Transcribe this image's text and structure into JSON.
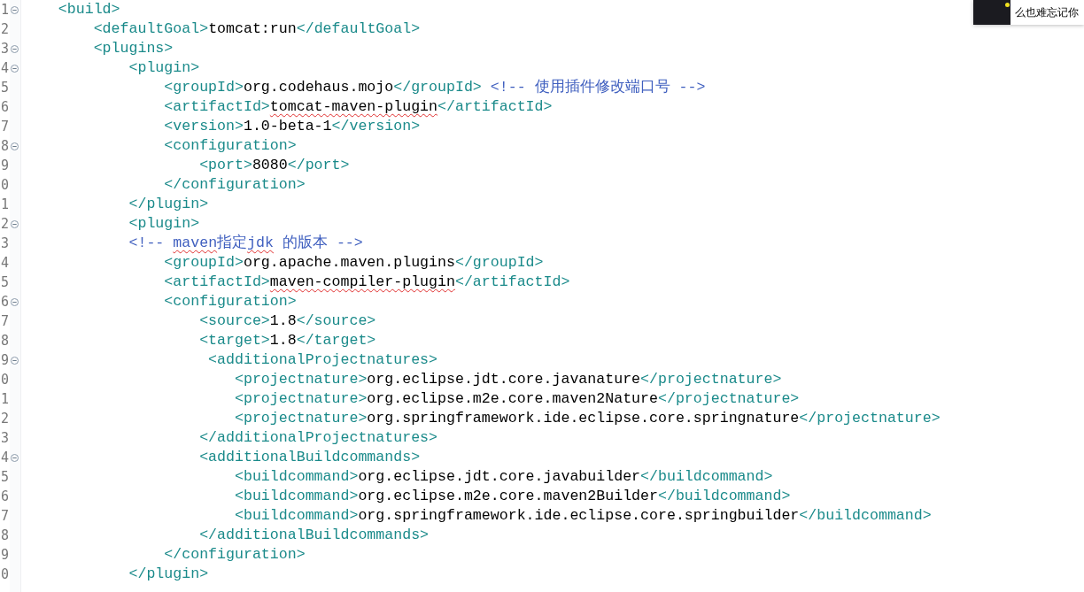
{
  "editor": {
    "lines": [
      {
        "number": "1",
        "foldable": true,
        "tokens": [
          {
            "kind": "tag",
            "text": "    <build>"
          }
        ]
      },
      {
        "number": "2",
        "foldable": false,
        "tokens": [
          {
            "kind": "tag",
            "text": "        <defaultGoal>"
          },
          {
            "kind": "text",
            "text": "tomcat:run"
          },
          {
            "kind": "tag",
            "text": "</defaultGoal>"
          }
        ]
      },
      {
        "number": "3",
        "foldable": true,
        "tokens": [
          {
            "kind": "tag",
            "text": "        <plugins>"
          }
        ]
      },
      {
        "number": "4",
        "foldable": true,
        "tokens": [
          {
            "kind": "tag",
            "text": "            <plugin>"
          }
        ]
      },
      {
        "number": "5",
        "foldable": false,
        "tokens": [
          {
            "kind": "tag",
            "text": "                <groupId>"
          },
          {
            "kind": "text",
            "text": "org.codehaus.mojo"
          },
          {
            "kind": "tag",
            "text": "</groupId>"
          },
          {
            "kind": "comment",
            "text": " <!-- 使用插件修改端口号 -->"
          }
        ]
      },
      {
        "number": "6",
        "foldable": false,
        "tokens": [
          {
            "kind": "tag",
            "text": "                <artifactId>"
          },
          {
            "kind": "text",
            "text": "tomcat-maven-plugin",
            "misspelled": true
          },
          {
            "kind": "tag",
            "text": "</artifactId>"
          }
        ]
      },
      {
        "number": "7",
        "foldable": false,
        "tokens": [
          {
            "kind": "tag",
            "text": "                <version>"
          },
          {
            "kind": "text",
            "text": "1.0-beta-1"
          },
          {
            "kind": "tag",
            "text": "</version>"
          }
        ]
      },
      {
        "number": "8",
        "foldable": true,
        "tokens": [
          {
            "kind": "tag",
            "text": "                <configuration>"
          }
        ]
      },
      {
        "number": "9",
        "foldable": false,
        "tokens": [
          {
            "kind": "tag",
            "text": "                    <port>"
          },
          {
            "kind": "text",
            "text": "8080"
          },
          {
            "kind": "tag",
            "text": "</port>"
          }
        ]
      },
      {
        "number": "0",
        "foldable": false,
        "tokens": [
          {
            "kind": "tag",
            "text": "                </configuration>"
          }
        ]
      },
      {
        "number": "1",
        "foldable": false,
        "tokens": [
          {
            "kind": "tag",
            "text": "            </plugin>"
          }
        ]
      },
      {
        "number": "2",
        "foldable": true,
        "tokens": [
          {
            "kind": "tag",
            "text": "            <plugin>"
          }
        ]
      },
      {
        "number": "3",
        "foldable": false,
        "tokens": [
          {
            "kind": "comment",
            "text": "            <!-- "
          },
          {
            "kind": "comment",
            "text": "maven",
            "misspelled": true
          },
          {
            "kind": "comment",
            "text": "指定"
          },
          {
            "kind": "comment",
            "text": "jdk",
            "misspelled": true
          },
          {
            "kind": "comment",
            "text": " 的版本 -->"
          }
        ]
      },
      {
        "number": "4",
        "foldable": false,
        "tokens": [
          {
            "kind": "tag",
            "text": "                <groupId>"
          },
          {
            "kind": "text",
            "text": "org.apache.maven.plugins"
          },
          {
            "kind": "tag",
            "text": "</groupId>"
          }
        ]
      },
      {
        "number": "5",
        "foldable": false,
        "tokens": [
          {
            "kind": "tag",
            "text": "                <artifactId>"
          },
          {
            "kind": "text",
            "text": "maven-compiler-plugin",
            "misspelled": true
          },
          {
            "kind": "tag",
            "text": "</artifactId>"
          }
        ]
      },
      {
        "number": "6",
        "foldable": true,
        "tokens": [
          {
            "kind": "tag",
            "text": "                <configuration>"
          }
        ]
      },
      {
        "number": "7",
        "foldable": false,
        "tokens": [
          {
            "kind": "tag",
            "text": "                    <source>"
          },
          {
            "kind": "text",
            "text": "1.8"
          },
          {
            "kind": "tag",
            "text": "</source>"
          }
        ]
      },
      {
        "number": "8",
        "foldable": false,
        "tokens": [
          {
            "kind": "tag",
            "text": "                    <target>"
          },
          {
            "kind": "text",
            "text": "1.8"
          },
          {
            "kind": "tag",
            "text": "</target>"
          }
        ]
      },
      {
        "number": "9",
        "foldable": true,
        "tokens": [
          {
            "kind": "tag",
            "text": "                     <additionalProjectnatures>"
          }
        ]
      },
      {
        "number": "0",
        "foldable": false,
        "tokens": [
          {
            "kind": "tag",
            "text": "                        <projectnature>"
          },
          {
            "kind": "text",
            "text": "org.eclipse.jdt.core.javanature"
          },
          {
            "kind": "tag",
            "text": "</projectnature>"
          }
        ]
      },
      {
        "number": "1",
        "foldable": false,
        "tokens": [
          {
            "kind": "tag",
            "text": "                        <projectnature>"
          },
          {
            "kind": "text",
            "text": "org.eclipse.m2e.core.maven2Nature"
          },
          {
            "kind": "tag",
            "text": "</projectnature>"
          }
        ]
      },
      {
        "number": "2",
        "foldable": false,
        "tokens": [
          {
            "kind": "tag",
            "text": "                        <projectnature>"
          },
          {
            "kind": "text",
            "text": "org.springframework.ide.eclipse.core.springnature"
          },
          {
            "kind": "tag",
            "text": "</projectnature>"
          }
        ]
      },
      {
        "number": "3",
        "foldable": false,
        "tokens": [
          {
            "kind": "tag",
            "text": "                    </additionalProjectnatures>"
          }
        ]
      },
      {
        "number": "4",
        "foldable": true,
        "tokens": [
          {
            "kind": "tag",
            "text": "                    <additionalBuildcommands>"
          }
        ]
      },
      {
        "number": "5",
        "foldable": false,
        "tokens": [
          {
            "kind": "tag",
            "text": "                        <buildcommand>"
          },
          {
            "kind": "text",
            "text": "org.eclipse.jdt.core.javabuilder"
          },
          {
            "kind": "tag",
            "text": "</buildcommand>"
          }
        ]
      },
      {
        "number": "6",
        "foldable": false,
        "tokens": [
          {
            "kind": "tag",
            "text": "                        <buildcommand>"
          },
          {
            "kind": "text",
            "text": "org.eclipse.m2e.core.maven2Builder"
          },
          {
            "kind": "tag",
            "text": "</buildcommand>"
          }
        ]
      },
      {
        "number": "7",
        "foldable": false,
        "tokens": [
          {
            "kind": "tag",
            "text": "                        <buildcommand>"
          },
          {
            "kind": "text",
            "text": "org.springframework.ide.eclipse.core.springbuilder"
          },
          {
            "kind": "tag",
            "text": "</buildcommand>"
          }
        ]
      },
      {
        "number": "8",
        "foldable": false,
        "tokens": [
          {
            "kind": "tag",
            "text": "                    </additionalBuildcommands>"
          }
        ]
      },
      {
        "number": "9",
        "foldable": false,
        "tokens": [
          {
            "kind": "tag",
            "text": "                </configuration>"
          }
        ]
      },
      {
        "number": "0",
        "foldable": false,
        "tokens": [
          {
            "kind": "tag",
            "text": "            </plugin>"
          }
        ]
      }
    ]
  },
  "notification": {
    "text": "么也难忘记你"
  }
}
